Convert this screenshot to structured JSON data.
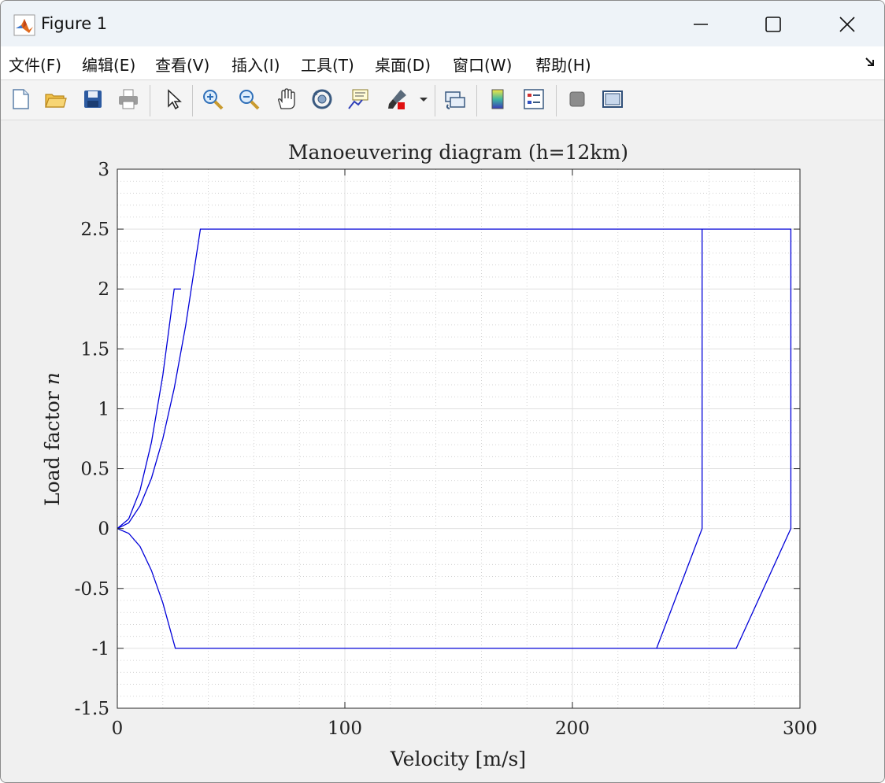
{
  "window": {
    "title": "Figure 1",
    "minimize_label": "Minimize",
    "maximize_label": "Maximize",
    "close_label": "Close"
  },
  "menu": {
    "items": [
      "文件(F)",
      "编辑(E)",
      "查看(V)",
      "插入(I)",
      "工具(T)",
      "桌面(D)",
      "窗口(W)",
      "帮助(H)"
    ]
  },
  "toolbar": {
    "icons": [
      "new-file-icon",
      "open-folder-icon",
      "save-icon",
      "print-icon",
      "pointer-icon",
      "zoom-in-icon",
      "zoom-out-icon",
      "pan-hand-icon",
      "rotate-3d-icon",
      "data-cursor-icon",
      "brush-icon",
      "brush-dropdown-icon",
      "link-plot-icon",
      "colorbar-icon",
      "legend-icon",
      "hide-plot-tools-icon",
      "show-plot-tools-icon"
    ]
  },
  "colors": {
    "line": "#0000d9",
    "grid": "#e0e0e0",
    "minor_grid": "#c8c8c8",
    "axes_bg": "#ffffff",
    "figure_bg": "#f0f0f0"
  },
  "chart_data": {
    "type": "line",
    "title": "Manoeuvering diagram (h=12km)",
    "xlabel": "Velocity [m/s]",
    "ylabel": "Load factor n",
    "xlim": [
      0,
      300
    ],
    "ylim": [
      -1.5,
      3
    ],
    "xticks": [
      0,
      100,
      200,
      300
    ],
    "yticks": [
      -1.5,
      -1,
      -0.5,
      0,
      0.5,
      1,
      1.5,
      2,
      2.5,
      3
    ],
    "ytick_labels": [
      "-1.5",
      "-1",
      "-0.5",
      "0",
      "0.5",
      "1",
      "1.5",
      "2",
      "2.5",
      "3"
    ],
    "grid": true,
    "minor_grid": true,
    "series": [
      {
        "x": [
          0,
          5,
          10,
          15,
          20,
          25,
          28
        ],
        "y": [
          0,
          0.08,
          0.32,
          0.72,
          1.28,
          2.0,
          2.0
        ]
      },
      {
        "x": [
          0,
          5,
          10,
          15,
          20,
          25,
          30,
          36.5,
          257,
          257,
          237,
          25.5,
          20,
          15,
          10,
          5,
          0
        ],
        "y": [
          0,
          0.047,
          0.19,
          0.42,
          0.75,
          1.17,
          1.69,
          2.5,
          2.5,
          0,
          -1,
          -1,
          -0.62,
          -0.35,
          -0.15,
          -0.04,
          0
        ]
      },
      {
        "x": [
          257,
          296,
          296,
          272,
          237
        ],
        "y": [
          2.5,
          2.5,
          0,
          -1,
          -1
        ]
      }
    ]
  }
}
